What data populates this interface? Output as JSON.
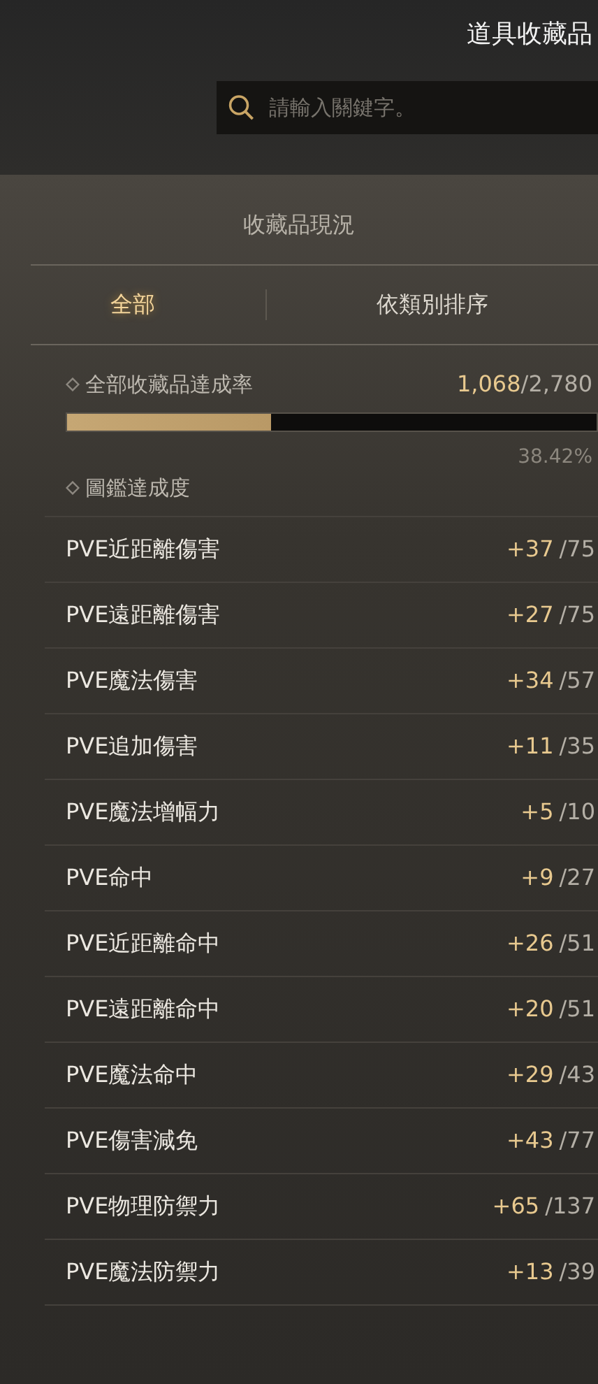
{
  "title": "道具收藏品",
  "search": {
    "placeholder": "請輸入關鍵字。"
  },
  "section_title": "收藏品現況",
  "tabs": [
    {
      "label": "全部",
      "selected": true
    },
    {
      "label": "依類別排序",
      "selected": false
    }
  ],
  "overall": {
    "label": "全部收藏品達成率",
    "count": "1,068",
    "total": "/2,780",
    "level": 0.3842,
    "percent": "38.42%"
  },
  "codex_label": "圖鑑達成度",
  "stats": [
    {
      "name": "PVE近距離傷害",
      "bonus": "+37",
      "max": "/75"
    },
    {
      "name": "PVE遠距離傷害",
      "bonus": "+27",
      "max": "/75"
    },
    {
      "name": "PVE魔法傷害",
      "bonus": "+34",
      "max": "/57"
    },
    {
      "name": "PVE追加傷害",
      "bonus": "+11",
      "max": "/35"
    },
    {
      "name": "PVE魔法增幅力",
      "bonus": "+5",
      "max": "/10"
    },
    {
      "name": "PVE命中",
      "bonus": "+9",
      "max": "/27"
    },
    {
      "name": "PVE近距離命中",
      "bonus": "+26",
      "max": "/51"
    },
    {
      "name": "PVE遠距離命中",
      "bonus": "+20",
      "max": "/51"
    },
    {
      "name": "PVE魔法命中",
      "bonus": "+29",
      "max": "/43"
    },
    {
      "name": "PVE傷害減免",
      "bonus": "+43",
      "max": "/77"
    },
    {
      "name": "PVE物理防禦力",
      "bonus": "+65",
      "max": "/137"
    },
    {
      "name": "PVE魔法防禦力",
      "bonus": "+13",
      "max": "/39"
    }
  ]
}
